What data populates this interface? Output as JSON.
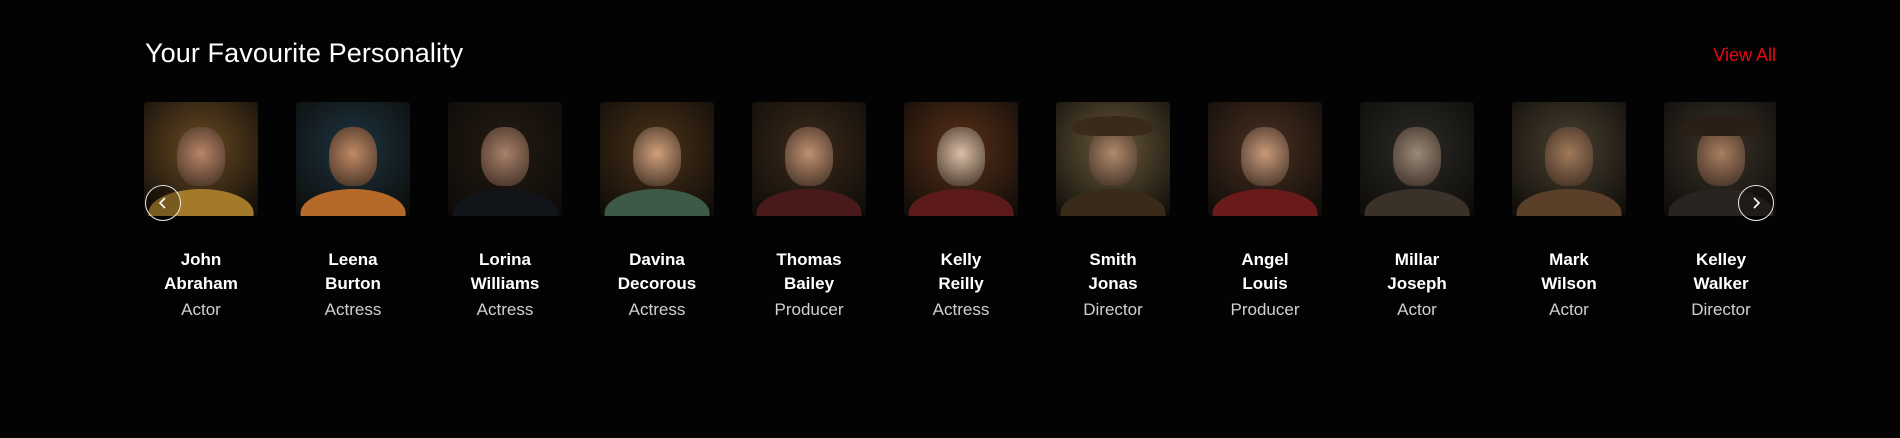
{
  "section": {
    "title": "Your Favourite Personality",
    "view_all": "View All",
    "accent": "#e50914"
  },
  "nav": {
    "prev_icon": "chevron-left-icon",
    "next_icon": "chevron-right-icon"
  },
  "people": [
    {
      "name": "John Abraham",
      "role": "Actor",
      "bg": "#6a4a22",
      "skin": "#b98566",
      "cloth": "#a37a2a"
    },
    {
      "name": "Leena Burton",
      "role": "Actress",
      "bg": "#1d3440",
      "skin": "#c08a64",
      "cloth": "#b56a2a"
    },
    {
      "name": "Lorina Williams",
      "role": "Actress",
      "bg": "#241a12",
      "skin": "#a8806a",
      "cloth": "#111419"
    },
    {
      "name": "Davina Decorous",
      "role": "Actress",
      "bg": "#4a3218",
      "skin": "#d0a07a",
      "cloth": "#3c5a46"
    },
    {
      "name": "Thomas Bailey",
      "role": "Producer",
      "bg": "#3c2a1a",
      "skin": "#c09070",
      "cloth": "#4a1a1a"
    },
    {
      "name": "Kelly Reilly",
      "role": "Actress",
      "bg": "#5a3018",
      "skin": "#dcc0a8",
      "cloth": "#5c1a1a"
    },
    {
      "name": "Smith Jonas",
      "role": "Director",
      "bg": "#6a5a3a",
      "skin": "#b08a6c",
      "cloth": "#3a2a1a",
      "hat": "#3a2a1c"
    },
    {
      "name": "Angel Louis",
      "role": "Producer",
      "bg": "#4a3020",
      "skin": "#c89a7a",
      "cloth": "#6a1a1a"
    },
    {
      "name": "Millar Joseph",
      "role": "Actor",
      "bg": "#2a2a26",
      "skin": "#9a8a7a",
      "cloth": "#3a3228"
    },
    {
      "name": "Mark Wilson",
      "role": "Actor",
      "bg": "#4a4030",
      "skin": "#a07a5a",
      "cloth": "#5a4028"
    },
    {
      "name": "Kelley Walker",
      "role": "Director",
      "bg": "#3a3228",
      "skin": "#a87e60",
      "cloth": "#2a2420",
      "hat": "#2a1e16"
    }
  ]
}
